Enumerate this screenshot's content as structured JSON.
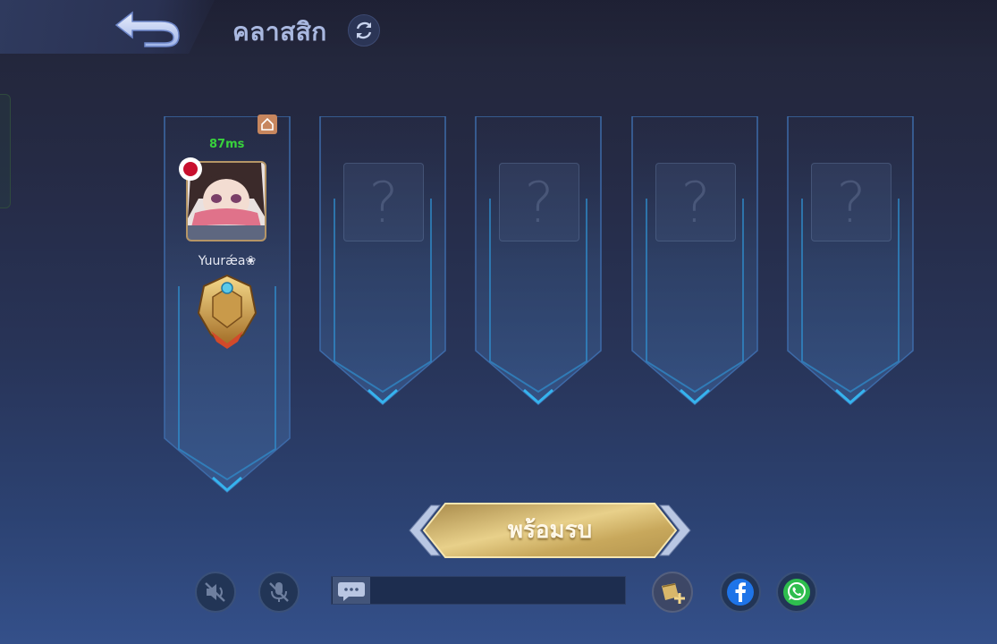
{
  "header": {
    "title": "คลาสสิก",
    "back_icon": "back-arrow-icon",
    "refresh_icon": "refresh-icon"
  },
  "lobby": {
    "host": {
      "ping": "87ms",
      "name": "Yuurǽa❀",
      "home_icon": "home-icon",
      "country_badge": "japan-flag-icon",
      "rank_icon": "mythic-rank-emblem",
      "ping_color": "#38d23c"
    },
    "empty_slots": [
      {
        "label": "?"
      },
      {
        "label": "?"
      },
      {
        "label": "?"
      },
      {
        "label": "?"
      }
    ]
  },
  "ready_button": {
    "label": "พร้อมรบ"
  },
  "bottom_bar": {
    "speaker_icon": "speaker-muted-icon",
    "mic_icon": "mic-muted-icon",
    "chat_icon": "chat-bubble-icon",
    "chat_placeholder": "",
    "invite_icon": "invite-plus-icon",
    "facebook_icon": "facebook-icon",
    "whatsapp_icon": "whatsapp-icon"
  },
  "colors": {
    "accent_blue": "#2fa8e8",
    "gold": "#d8b86a",
    "facebook": "#1e74e8",
    "whatsapp": "#2ebd4e"
  }
}
